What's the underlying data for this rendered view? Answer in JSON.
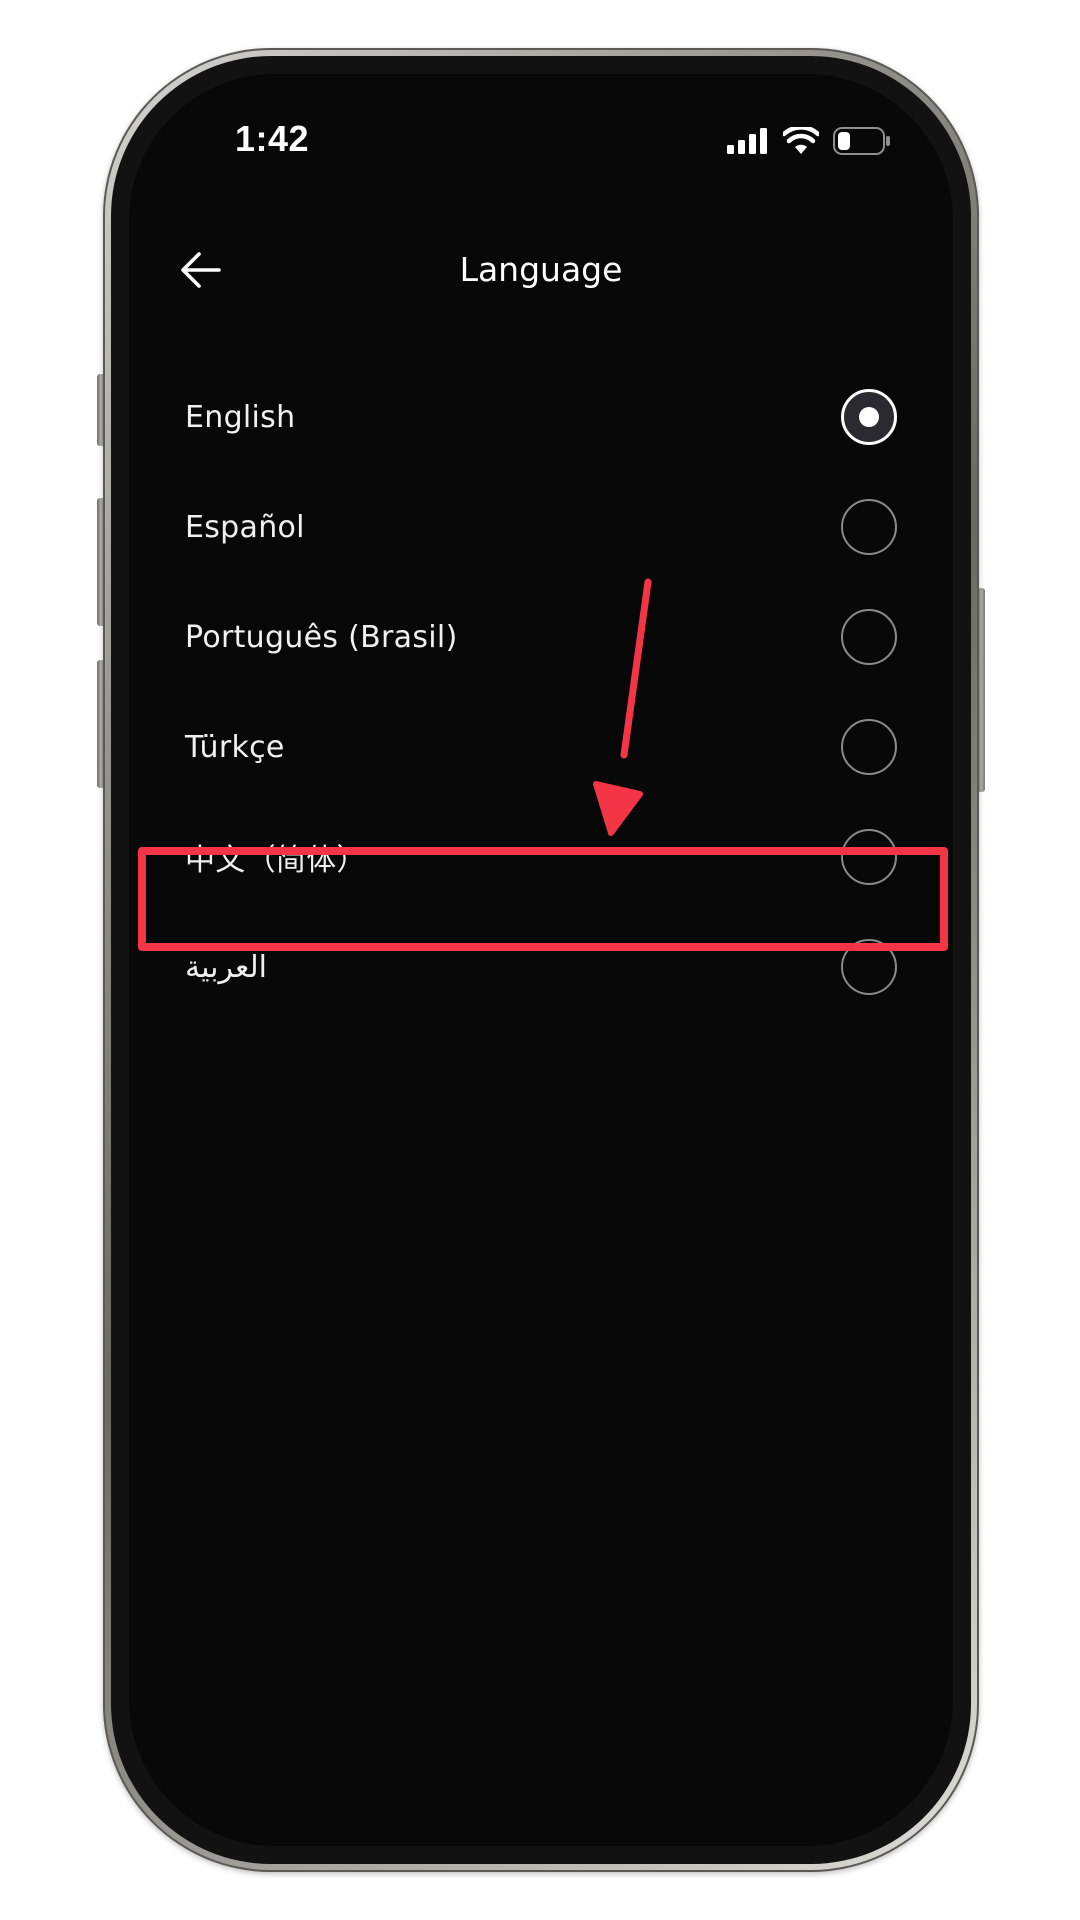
{
  "status_bar": {
    "time": "1:42",
    "icons": [
      "cellular-signal-icon",
      "wifi-icon",
      "battery-icon"
    ]
  },
  "header": {
    "back_icon": "arrow-left-icon",
    "title": "Language"
  },
  "languages": [
    {
      "label": "English",
      "selected": true
    },
    {
      "label": "Español",
      "selected": false
    },
    {
      "label": "Português (Brasil)",
      "selected": false
    },
    {
      "label": "Türkçe",
      "selected": false
    },
    {
      "label": "中文（简体）",
      "selected": false
    },
    {
      "label": "العربية",
      "selected": false
    }
  ],
  "annotation": {
    "color": "#f43546",
    "highlighted_item": "العربية"
  },
  "colors": {
    "screen_background": "#080808",
    "text": "#ffffff",
    "radio_border": "#8a8a8a"
  }
}
